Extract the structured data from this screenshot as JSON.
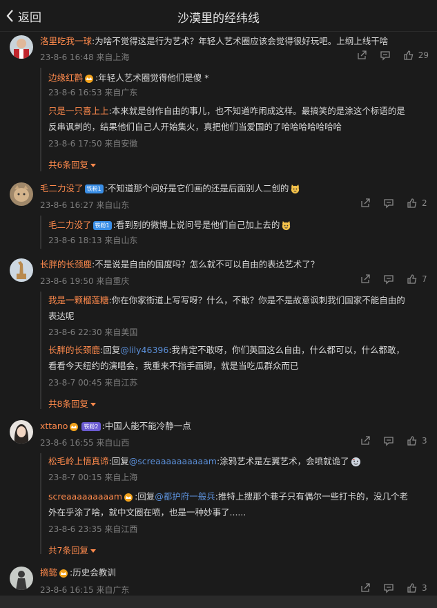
{
  "header": {
    "back_label": "返回",
    "title": "沙漠里的经纬线"
  },
  "comments": [
    {
      "user": "洛里吃我一球",
      "text": ":为啥不觉得这是行为艺术？年轻人艺术圈应该会觉得很好玩吧。上纲上线干啥",
      "time": "23-8-6 16:48 来自上海",
      "likes": "29",
      "replies": [
        {
          "user": "边缘红鹳",
          "text": ":年轻人艺术圈觉得他们是傻 *",
          "time": "23-8-6 16:53 来自广东"
        },
        {
          "user": "只是一只喜上上",
          "text1": ":本来就是创作自由的事儿，也不知道咋闹成这样。最搞笑的是涂这个标语的是",
          "text2": "反串讽刺的，结果他们自己人开始集火，真把他们当爱国的了哈哈哈哈哈哈哈",
          "time": "23-8-6 17:50 来自安徽"
        }
      ],
      "more_label": "共6条回复"
    },
    {
      "user": "毛二力没了",
      "badge": "铁粉1",
      "text": ":不知道那个问好是它们画的还是后面别人二创的",
      "time": "23-8-6 16:27 来自山东",
      "likes": "2",
      "replies": [
        {
          "user": "毛二力没了",
          "badge": "铁粉1",
          "text": ":看到别的微博上说问号是他们自己加上去的",
          "time": "23-8-6 18:13 来自山东"
        }
      ]
    },
    {
      "user": "长胖的长颈鹿",
      "text": ":不是说是自由的国度吗？怎么就不可以自由的表达艺术了？",
      "time": "23-8-6 19:50 来自重庆",
      "likes": "7",
      "replies": [
        {
          "user": "我是一颗榴莲糖",
          "text1": ":你在你家街道上写写呀？什么，不敢？你是不是故意讽刺我们国家不能自由的",
          "text2": "表达呢",
          "time": "23-8-6 22:30 来自美国"
        },
        {
          "user": "长胖的长颈鹿",
          "reply_prefix": ":回复",
          "reply_to": "@lily46396",
          "text1": ":我肯定不敢呀，你们英国这么自由，什么都可以，什么都敢，",
          "text2": "看看今天纽约的演唱会，我重来不指手画脚，就是当吃瓜群众而已",
          "time": "23-8-7 00:45 来自江苏"
        }
      ],
      "more_label": "共8条回复"
    },
    {
      "user": "xttano",
      "badge": "铁粉2",
      "text": ":中国人能不能冷静一点",
      "time": "23-8-6 16:55 来自山西",
      "likes": "3",
      "replies": [
        {
          "user": "松毛岭上悟真谛",
          "reply_prefix": ":回复",
          "reply_to": "@screaaaaaaaaaam",
          "text": ":涂鸦艺术是左翼艺术，会喷就诡了",
          "time": "23-8-7 00:15 来自上海"
        },
        {
          "user": "screaaaaaaaaam",
          "reply_prefix": ":回复",
          "reply_to": "@都护府一般兵",
          "text1": ":推特上搜那个巷子只有偶尔一些打卡的，没几个老",
          "text2": "外在乎涂了啥，就中文圈在喷，也是一种妙事了......",
          "time": "23-8-6 23:35 来自江西"
        }
      ],
      "more_label": "共7条回复"
    },
    {
      "user": "摘懿",
      "text": ":历史会教训",
      "time": "23-8-6 16:15 来自广东",
      "likes": "3"
    }
  ],
  "colors": {
    "background": "#1b1b1b",
    "username": "#ff8a4c",
    "link": "#5b8fd8",
    "meta": "#7d7d7d",
    "badge_blue": "#3a8ee6"
  },
  "icons": [
    "back-chevron-icon",
    "share-icon",
    "comment-icon",
    "like-icon",
    "crown-icon",
    "cat-emoji-icon"
  ]
}
